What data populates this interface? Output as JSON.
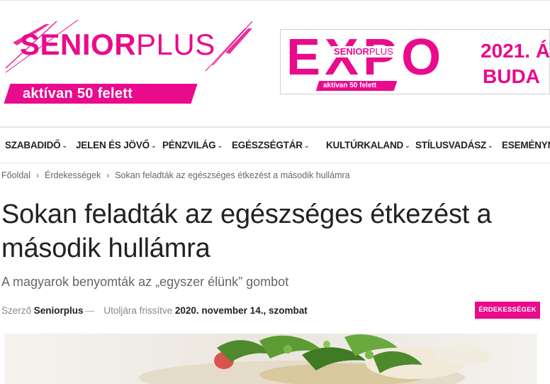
{
  "logo": {
    "word_bold": "SENIOR",
    "word_light": "PLUS",
    "tagline": "aktívan 50 felett"
  },
  "banner": {
    "expo": "EXPO",
    "mini_logo_bold": "SENIOR",
    "mini_logo_light": "PLUS",
    "mini_tagline": "aktívan 50 felett",
    "year_text": "2021. Á",
    "city_text": "BUDA"
  },
  "nav": {
    "items": [
      {
        "label": "SZABADIDŐ"
      },
      {
        "label": "JELEN ÉS JÖVŐ"
      },
      {
        "label": "PÉNZVILÁG"
      },
      {
        "label": "EGÉSZSÉGTÁR"
      },
      {
        "label": "KULTÚRKALAND"
      },
      {
        "label": "STÍLUSVADÁSZ"
      },
      {
        "label": "ESEMÉNYN"
      }
    ]
  },
  "breadcrumb": {
    "home": "Főoldal",
    "category": "Érdekességek",
    "current": "Sokan feladták az egészséges étkezést a második hullámra"
  },
  "article": {
    "title": "Sokan feladták az egészséges étkezést a második hullámra",
    "subtitle": "A magyarok benyomták az „egyszer élünk” gombot",
    "author_prefix": "Szerző",
    "author": "Seniorplus",
    "dash": "—",
    "updated_prefix": "Utoljára frissítve",
    "date": "2020. november 14., szombat",
    "category_badge": "ÉRDEKESSÉGEK"
  },
  "colors": {
    "brand": "#ea0a8c",
    "text": "#222222",
    "muted": "#888888"
  }
}
